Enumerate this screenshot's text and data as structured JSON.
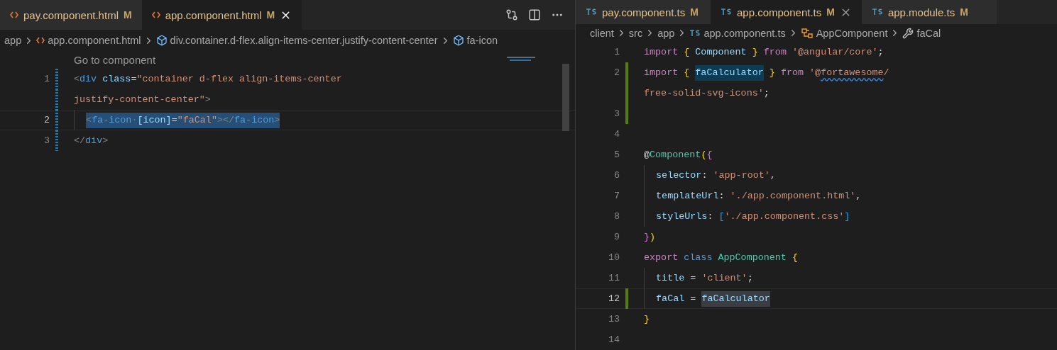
{
  "left_editor": {
    "tabs": [
      {
        "label": "pay.component.html",
        "kind": "html",
        "badge": "M",
        "selected": false
      },
      {
        "label": "app.component.html",
        "kind": "html",
        "badge": "M",
        "selected": true
      }
    ],
    "breadcrumbs": [
      {
        "label": "app"
      },
      {
        "label": "app.component.html",
        "kind": "html"
      },
      {
        "label": "div.container.d-flex.align-items-center.justify-content-center",
        "kind": "element"
      },
      {
        "label": "fa-icon",
        "kind": "element"
      }
    ],
    "codelens": "Go to component",
    "lines": [
      {
        "number": "1",
        "current": false,
        "modified": true,
        "tokens": [
          {
            "kind": "punct",
            "text": "<"
          },
          {
            "kind": "tag",
            "text": "div"
          },
          {
            "kind": "attr",
            "text": " class"
          },
          {
            "kind": "plain",
            "text": "="
          },
          {
            "kind": "string",
            "text": "\"container d-flex align-items-center"
          }
        ],
        "continuation": [
          {
            "kind": "string",
            "text": "justify-content-center\""
          },
          {
            "kind": "punct",
            "text": ">"
          }
        ]
      },
      {
        "number": "2",
        "current": true,
        "modified": true,
        "indented": true,
        "tokens": [
          {
            "kind": "punct",
            "text": "<",
            "selected": true
          },
          {
            "kind": "tag",
            "text": "fa-icon",
            "selected": true
          },
          {
            "kind": "whitespace",
            "text": "·",
            "selected": true
          },
          {
            "kind": "attr",
            "text": "[icon]",
            "selected": true
          },
          {
            "kind": "plain",
            "text": "=",
            "selected": true
          },
          {
            "kind": "string",
            "text": "\"faCal\"",
            "selected": true
          },
          {
            "kind": "punct",
            "text": "></",
            "selected": true
          },
          {
            "kind": "tag",
            "text": "fa-icon",
            "selected": true
          },
          {
            "kind": "punct",
            "text": ">",
            "selected": true
          }
        ]
      },
      {
        "number": "3",
        "current": false,
        "modified": true,
        "tokens": [
          {
            "kind": "punct",
            "text": "</"
          },
          {
            "kind": "tag",
            "text": "div"
          },
          {
            "kind": "punct",
            "text": ">"
          }
        ]
      }
    ]
  },
  "right_editor": {
    "tabs": [
      {
        "label": "pay.component.ts",
        "kind": "ts",
        "badge": "M",
        "selected": false
      },
      {
        "label": "app.component.ts",
        "kind": "ts",
        "badge": "M",
        "selected": true
      },
      {
        "label": "app.module.ts",
        "kind": "ts",
        "badge": "M",
        "selected": false
      }
    ],
    "breadcrumbs": [
      {
        "label": "client"
      },
      {
        "label": "src"
      },
      {
        "label": "app"
      },
      {
        "label": "app.component.ts",
        "kind": "ts"
      },
      {
        "label": "AppComponent",
        "kind": "class"
      },
      {
        "label": "faCal",
        "kind": "property"
      }
    ],
    "lines": [
      {
        "number": "1",
        "current": false,
        "tokens": [
          {
            "kind": "keyword",
            "text": "import "
          },
          {
            "kind": "brace1",
            "text": "{"
          },
          {
            "kind": "var",
            "text": " Component "
          },
          {
            "kind": "brace1",
            "text": "}"
          },
          {
            "kind": "keyword",
            "text": " from "
          },
          {
            "kind": "string",
            "text": "'@angular/core'"
          },
          {
            "kind": "plain",
            "text": ";"
          }
        ]
      },
      {
        "number": "2",
        "current": false,
        "added": true,
        "tokens": [
          {
            "kind": "keyword",
            "text": "import "
          },
          {
            "kind": "brace1",
            "text": "{ "
          },
          {
            "kind": "var",
            "text": "faCalculator",
            "symbol_highlight": true
          },
          {
            "kind": "brace1",
            "text": " }"
          },
          {
            "kind": "keyword",
            "text": " from "
          },
          {
            "kind": "string",
            "text": "'@"
          },
          {
            "kind": "string",
            "text": "fortawesome",
            "squiggle": true
          },
          {
            "kind": "string",
            "text": "/"
          }
        ],
        "continuation": [
          {
            "kind": "string",
            "text": "free-solid-svg-icons'"
          },
          {
            "kind": "plain",
            "text": ";"
          }
        ]
      },
      {
        "number": "3",
        "current": false,
        "added": true
      },
      {
        "number": "4",
        "current": false
      },
      {
        "number": "5",
        "current": false,
        "tokens": [
          {
            "kind": "plain",
            "text": "@"
          },
          {
            "kind": "type",
            "text": "Component"
          },
          {
            "kind": "brace1",
            "text": "("
          },
          {
            "kind": "brace2",
            "text": "{"
          }
        ]
      },
      {
        "number": "6",
        "current": false,
        "indented": true,
        "tokens": [
          {
            "kind": "var",
            "text": "selector"
          },
          {
            "kind": "plain",
            "text": ": "
          },
          {
            "kind": "string",
            "text": "'app-root'"
          },
          {
            "kind": "plain",
            "text": ","
          }
        ]
      },
      {
        "number": "7",
        "current": false,
        "indented": true,
        "tokens": [
          {
            "kind": "var",
            "text": "templateUrl"
          },
          {
            "kind": "plain",
            "text": ": "
          },
          {
            "kind": "string",
            "text": "'./app.component.html'"
          },
          {
            "kind": "plain",
            "text": ","
          }
        ]
      },
      {
        "number": "8",
        "current": false,
        "indented": true,
        "tokens": [
          {
            "kind": "var",
            "text": "styleUrls"
          },
          {
            "kind": "plain",
            "text": ": "
          },
          {
            "kind": "brace3",
            "text": "["
          },
          {
            "kind": "string",
            "text": "'./app.component.css'"
          },
          {
            "kind": "brace3",
            "text": "]"
          }
        ]
      },
      {
        "number": "9",
        "current": false,
        "tokens": [
          {
            "kind": "brace2",
            "text": "}"
          },
          {
            "kind": "brace1",
            "text": ")"
          }
        ]
      },
      {
        "number": "10",
        "current": false,
        "tokens": [
          {
            "kind": "keyword",
            "text": "export "
          },
          {
            "kind": "tag",
            "text": "class "
          },
          {
            "kind": "type",
            "text": "AppComponent "
          },
          {
            "kind": "brace1",
            "text": "{"
          }
        ]
      },
      {
        "number": "11",
        "current": false,
        "indented": true,
        "tokens": [
          {
            "kind": "var",
            "text": "title"
          },
          {
            "kind": "plain",
            "text": " = "
          },
          {
            "kind": "string",
            "text": "'client'"
          },
          {
            "kind": "plain",
            "text": ";"
          }
        ]
      },
      {
        "number": "12",
        "current": true,
        "added": true,
        "indented": true,
        "tokens": [
          {
            "kind": "var",
            "text": "faCal"
          },
          {
            "kind": "plain",
            "text": " = "
          },
          {
            "kind": "var",
            "text": "faCalculator",
            "occurrence_highlight": true
          }
        ]
      },
      {
        "number": "13",
        "current": false,
        "tokens": [
          {
            "kind": "brace1",
            "text": "}"
          }
        ]
      },
      {
        "number": "14",
        "current": false
      }
    ]
  }
}
